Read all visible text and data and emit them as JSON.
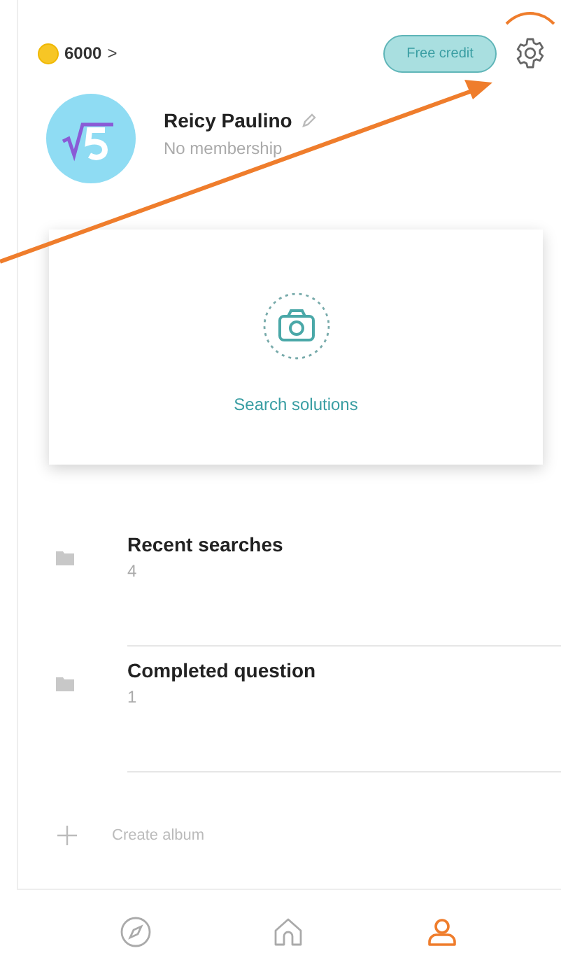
{
  "header": {
    "coins": "6000",
    "coins_arrow": ">",
    "free_credit": "Free credit"
  },
  "profile": {
    "name": "Reicy Paulino",
    "membership": "No membership"
  },
  "search_card": {
    "label": "Search solutions"
  },
  "albums": [
    {
      "title": "Recent searches",
      "count": "4"
    },
    {
      "title": "Completed question",
      "count": "1"
    }
  ],
  "create_album": "Create album",
  "tabs": [
    {
      "kind": "discover",
      "selected": false
    },
    {
      "kind": "home",
      "selected": false
    },
    {
      "kind": "profile",
      "selected": true
    }
  ]
}
